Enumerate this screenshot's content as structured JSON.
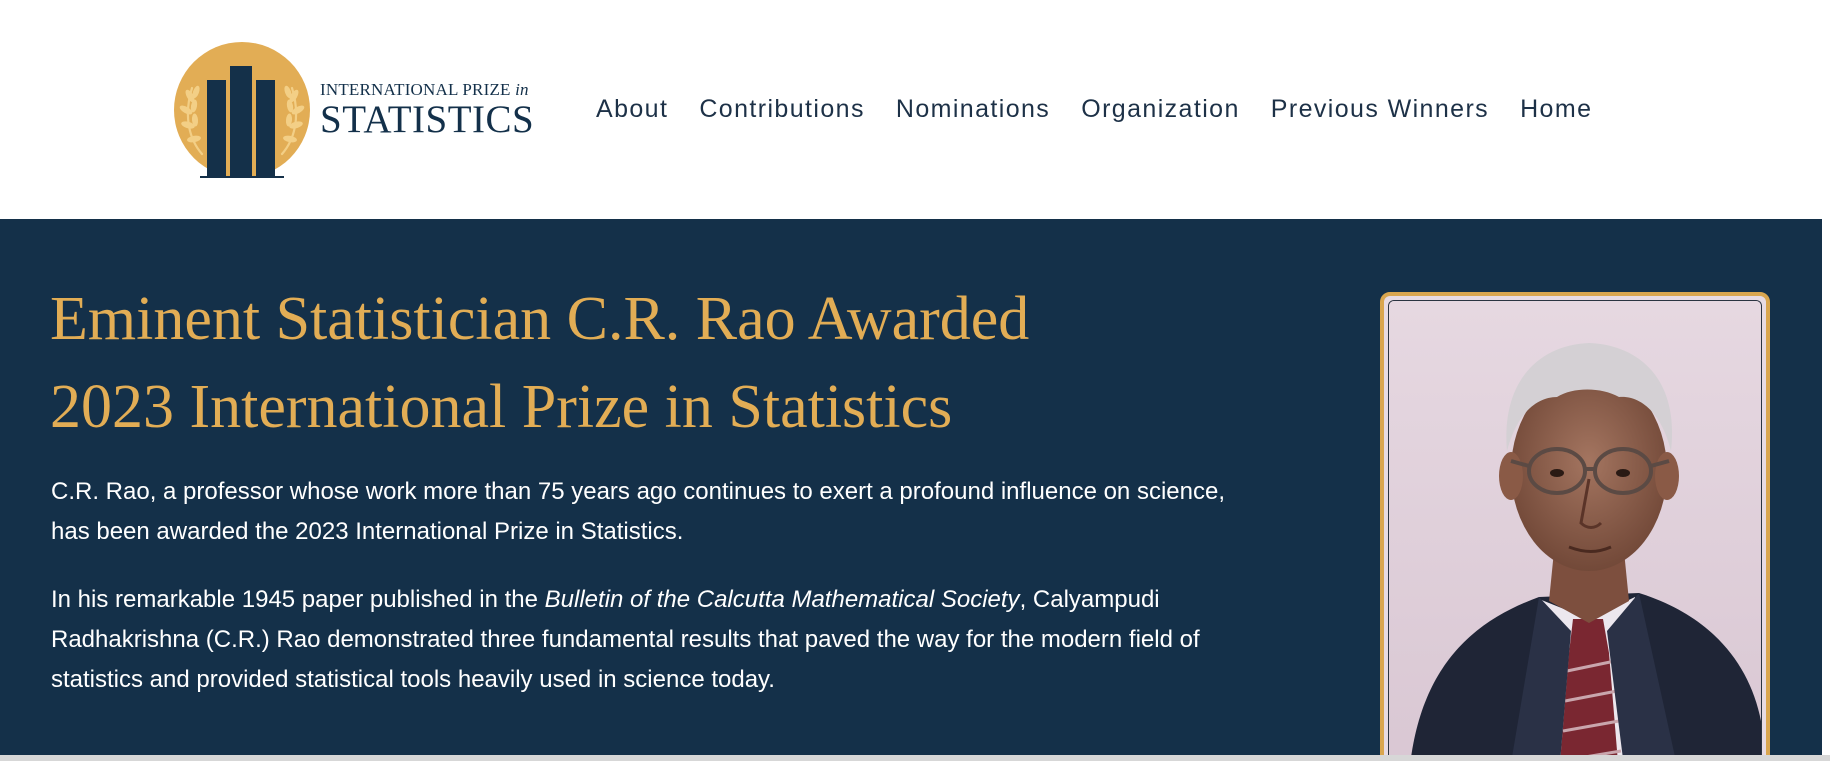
{
  "header": {
    "logo": {
      "line1": "INTERNATIONAL PRIZE",
      "line1_italic": "in",
      "line2": "STATISTICS"
    },
    "nav": [
      {
        "label": "About"
      },
      {
        "label": "Contributions"
      },
      {
        "label": "Nominations"
      },
      {
        "label": "Organization"
      },
      {
        "label": "Previous Winners"
      },
      {
        "label": "Home"
      }
    ]
  },
  "hero": {
    "headline_line1": "Eminent Statistician C.R. Rao Awarded",
    "headline_line2": "2023 International Prize in Statistics",
    "paragraph1": "C.R. Rao, a professor whose work more than 75 years ago continues to exert a profound influence on science, has been awarded the 2023 International Prize in Statistics.",
    "paragraph2_before": "In his remarkable 1945 paper published in the ",
    "paragraph2_italic": "Bulletin of the Calcutta Mathematical Society",
    "paragraph2_after": ", Calyampudi Radhakrishna (C.R.) Rao demonstrated three fundamental results that paved the way for the modern field of statistics and provided statistical tools heavily used in science today."
  },
  "colors": {
    "navy": "#143049",
    "gold": "#e2ad55",
    "nav_text": "#1d3147",
    "white": "#ffffff"
  },
  "icons": {
    "logo_emblem": "gold-medallion-with-columns-and-laurel-icon"
  }
}
